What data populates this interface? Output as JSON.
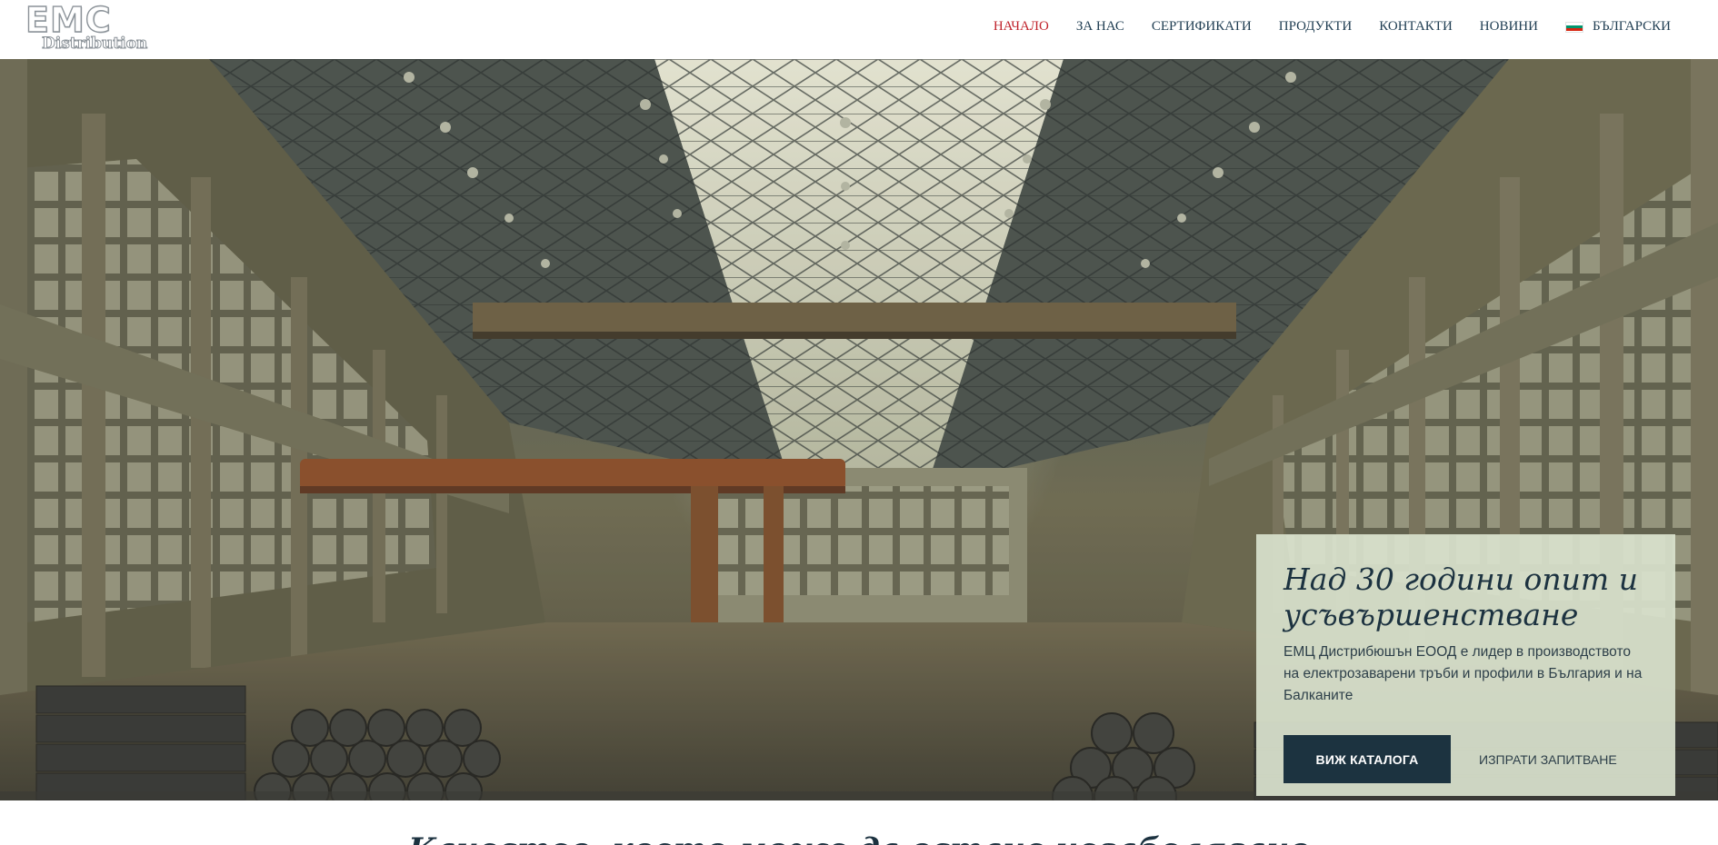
{
  "logo": {
    "line1": "EMC",
    "line2": "Distribution"
  },
  "nav": {
    "items": [
      "НАЧАЛО",
      "ЗА НАС",
      "СЕРТИФИКАТИ",
      "ПРОДУКТИ",
      "КОНТАКТИ",
      "НОВИНИ"
    ],
    "language": "БЪЛГАРСКИ",
    "flag_colors": [
      "#ffffff",
      "#00966e",
      "#d62612"
    ]
  },
  "colors": {
    "active_nav": "#c0232c",
    "primary": "#1c3340",
    "card_bg": "#d8e1cc"
  },
  "hero": {
    "card": {
      "title": "Над 30 години опит и усъвършенстване",
      "text": "ЕМЦ Дистрибюшън ЕООД е лидер в производството на електрозаварени тръби и профили в България и на Балканите",
      "primary_button": "ВИЖ КАТАЛОГА",
      "secondary_button": "ИЗПРАТИ ЗАПИТВАНЕ"
    }
  },
  "section": {
    "heading": "Качество, което може да остане незабелязано"
  }
}
